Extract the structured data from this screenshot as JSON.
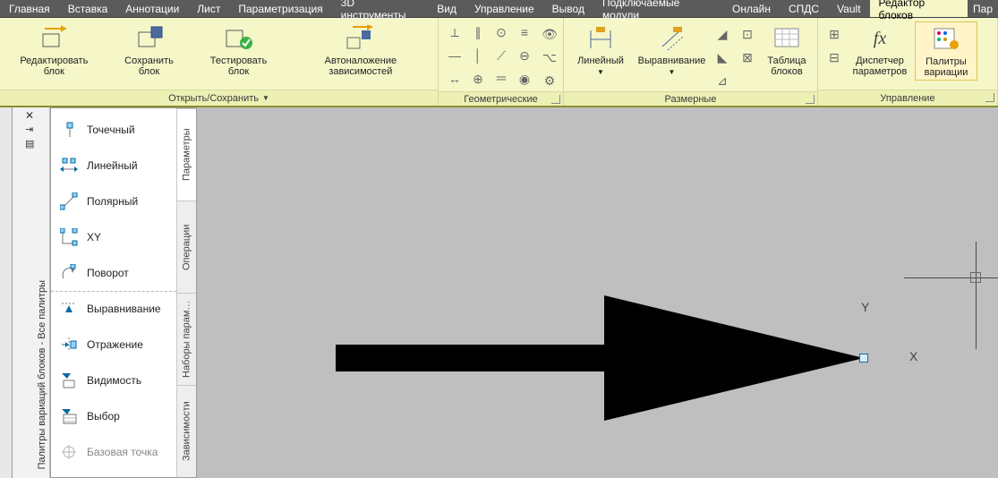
{
  "menu": {
    "items": [
      "Главная",
      "Вставка",
      "Аннотации",
      "Лист",
      "Параметризация",
      "3D инструменты",
      "Вид",
      "Управление",
      "Вывод",
      "Подключаемые модули",
      "Онлайн",
      "СПДС",
      "Vault",
      "Редактор блоков"
    ],
    "active_index": 13,
    "tail": "Пар"
  },
  "ribbon": {
    "panels": [
      {
        "title": "Открыть/Сохранить",
        "has_dropdown": true,
        "buttons": [
          {
            "name": "edit-block",
            "label": "Редактировать блок"
          },
          {
            "name": "save-block",
            "label": "Сохранить блок"
          },
          {
            "name": "test-block",
            "label": "Тестировать блок"
          },
          {
            "name": "auto-constr",
            "label": "Автоналожение зависимостей"
          }
        ]
      },
      {
        "title": "Геометрические",
        "has_corner": true,
        "grid_icons": 12,
        "side_icons": 3
      },
      {
        "title": "Размерные",
        "has_corner": true,
        "buttons": [
          {
            "name": "linear",
            "label": "Линейный",
            "dropdown": true
          },
          {
            "name": "align",
            "label": "Выравнивание",
            "dropdown": true
          }
        ],
        "side_icons": 3,
        "extra_icons": 2,
        "table_btn": {
          "name": "block-table",
          "label": "Таблица\nблоков"
        }
      },
      {
        "title": "Управление",
        "has_corner": true,
        "side_icons": 2,
        "buttons": [
          {
            "name": "param-mgr",
            "label": "Диспетчер\nпараметров"
          },
          {
            "name": "palettes",
            "label": "Палитры\nвариации",
            "selected": true
          }
        ]
      }
    ]
  },
  "sidebar": {
    "title": "Палитры вариаций блоков - Все палитры"
  },
  "palette": {
    "tabs": [
      "Параметры",
      "Операции",
      "Наборы парам…",
      "Зависимости"
    ],
    "active_tab": 0,
    "items": [
      {
        "name": "pal-point",
        "label": "Точечный"
      },
      {
        "name": "pal-linear",
        "label": "Линейный"
      },
      {
        "name": "pal-polar",
        "label": "Полярный"
      },
      {
        "name": "pal-xy",
        "label": "XY"
      },
      {
        "name": "pal-rotate",
        "label": "Поворот"
      },
      {
        "name": "pal-align",
        "label": "Выравнивание",
        "sep": true
      },
      {
        "name": "pal-mirror",
        "label": "Отражение"
      },
      {
        "name": "pal-vis",
        "label": "Видимость"
      },
      {
        "name": "pal-lookup",
        "label": "Выбор"
      },
      {
        "name": "pal-base",
        "label": "Базовая точка"
      }
    ]
  },
  "canvas": {
    "y_label": "Y",
    "x_label": "X"
  }
}
